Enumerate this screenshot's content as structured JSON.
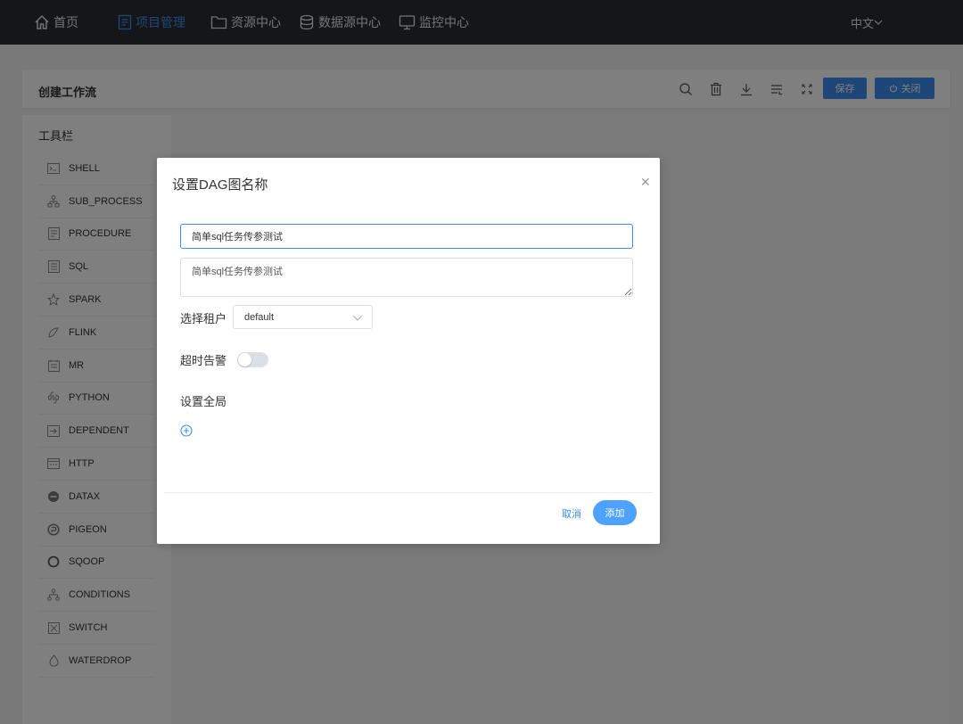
{
  "nav": {
    "items": [
      {
        "label": "首页",
        "icon": "home-icon"
      },
      {
        "label": "项目管理",
        "icon": "project-icon"
      },
      {
        "label": "资源中心",
        "icon": "folder-icon"
      },
      {
        "label": "数据源中心",
        "icon": "database-icon"
      },
      {
        "label": "监控中心",
        "icon": "monitor-icon"
      }
    ],
    "active_index": 1,
    "language": "中文"
  },
  "workflow": {
    "title": "创建工作流",
    "save_label": "保存",
    "close_label": "关闭",
    "toolbar_icons": [
      "search-icon",
      "delete-icon",
      "download-icon",
      "format-icon",
      "fullscreen-icon"
    ]
  },
  "sidebar": {
    "title": "工具栏",
    "items": [
      {
        "label": "SHELL",
        "icon": "shell-icon"
      },
      {
        "label": "SUB_PROCESS",
        "icon": "sub-process-icon"
      },
      {
        "label": "PROCEDURE",
        "icon": "procedure-icon"
      },
      {
        "label": "SQL",
        "icon": "sql-icon"
      },
      {
        "label": "SPARK",
        "icon": "spark-icon"
      },
      {
        "label": "FLINK",
        "icon": "flink-icon"
      },
      {
        "label": "MR",
        "icon": "mr-icon"
      },
      {
        "label": "PYTHON",
        "icon": "python-icon"
      },
      {
        "label": "DEPENDENT",
        "icon": "dependent-icon"
      },
      {
        "label": "HTTP",
        "icon": "http-icon"
      },
      {
        "label": "DATAX",
        "icon": "datax-icon"
      },
      {
        "label": "PIGEON",
        "icon": "pigeon-icon"
      },
      {
        "label": "SQOOP",
        "icon": "sqoop-icon"
      },
      {
        "label": "CONDITIONS",
        "icon": "conditions-icon"
      },
      {
        "label": "SWITCH",
        "icon": "switch-icon"
      },
      {
        "label": "WATERDROP",
        "icon": "waterdrop-icon"
      }
    ]
  },
  "modal": {
    "title": "设置DAG图名称",
    "name_value": "简单sql任务传参测试",
    "description_value": "简单sql任务传参测试",
    "tenant_label": "选择租户",
    "tenant_value": "default",
    "timeout_label": "超时告警",
    "timeout_enabled": false,
    "global_label": "设置全局",
    "cancel_label": "取消",
    "add_label": "添加"
  },
  "colors": {
    "accent": "#3d8ef0",
    "nav_bg": "#2a2d35"
  }
}
